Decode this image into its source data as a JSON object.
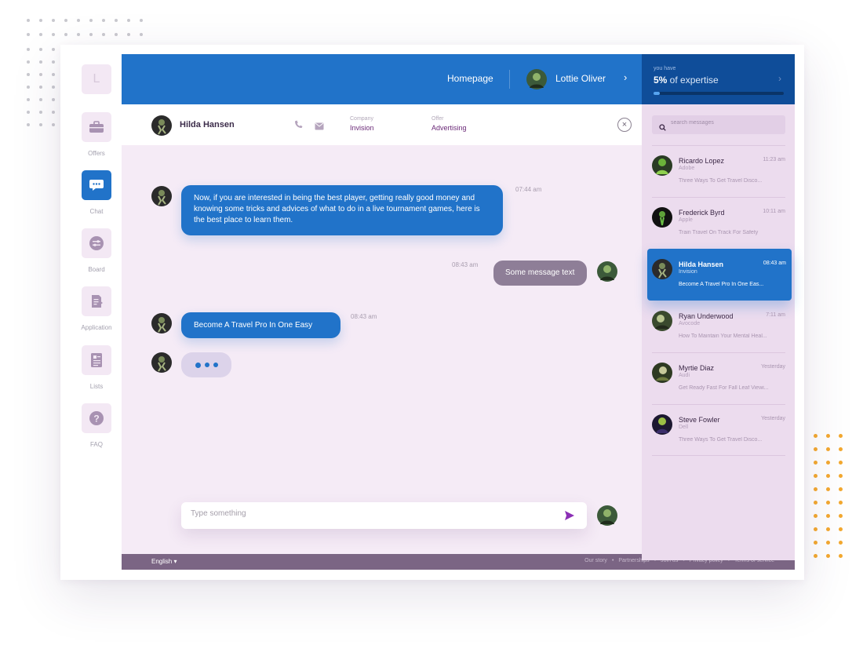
{
  "colors": {
    "accent": "#2173c9",
    "accent_dark": "#0f4d99",
    "panel": "#f5ebf6",
    "sidebar_right": "#ecdcee",
    "footer": "#7b6584",
    "decor_orange": "#f4a92f"
  },
  "nav": {
    "logo_letter": "L",
    "items": [
      {
        "label": "Offers",
        "icon": "briefcase-icon",
        "active": false
      },
      {
        "label": "Chat",
        "icon": "chat-bubble-icon",
        "active": true
      },
      {
        "label": "Board",
        "icon": "sliders-icon",
        "active": false
      },
      {
        "label": "Application",
        "icon": "document-arrow-icon",
        "active": false
      },
      {
        "label": "Lists",
        "icon": "list-document-icon",
        "active": false
      },
      {
        "label": "FAQ",
        "icon": "question-icon",
        "active": false
      }
    ]
  },
  "topbar": {
    "home_label": "Homepage",
    "user_name": "Lottie Oliver"
  },
  "expertise": {
    "prefix": "you have",
    "value": "5%",
    "suffix": " of expertise",
    "progress": 0.05
  },
  "chat": {
    "contact_name": "Hilda Hansen",
    "company_key": "Company",
    "company_value": "Invision",
    "offer_key": "Offer",
    "offer_value": "Advertising",
    "messages": [
      {
        "side": "left",
        "text": "Now, if you are interested in being the best player, getting really good money and knowing some tricks and advices of what to do in a live tournament games, here is the best place to learn them.",
        "time": "07:44 am"
      },
      {
        "side": "right",
        "text": "Some message text",
        "time": "08:43 am"
      },
      {
        "side": "left",
        "text": "Become A Travel Pro In One Easy",
        "time": "08:43 am"
      }
    ],
    "composer_placeholder": "Type something"
  },
  "search": {
    "placeholder": "search messages"
  },
  "conversations": [
    {
      "name": "Ricardo Lopez",
      "time": "11:23 am",
      "company": "Adobe",
      "preview": "Three Ways To Get Travel Disco...",
      "active": false
    },
    {
      "name": "Frederick Byrd",
      "time": "10:11 am",
      "company": "Apple",
      "preview": "Train Travel On Track For Safety",
      "active": false
    },
    {
      "name": "Hilda Hansen",
      "time": "08:43 am",
      "company": "Invision",
      "preview": "Become A Travel Pro In One Eas...",
      "active": true
    },
    {
      "name": "Ryan Underwood",
      "time": "7:11 am",
      "company": "Avocode",
      "preview": "How To Maintain Your Mental Heal...",
      "active": false
    },
    {
      "name": "Myrtie Diaz",
      "time": "Yesterday",
      "company": "Audi",
      "preview": "Get Ready Fast For Fall Leaf Viewi...",
      "active": false
    },
    {
      "name": "Steve Fowler",
      "time": "Yesterday",
      "company": "Dell",
      "preview": "Three Ways To Get Travel Disco...",
      "active": false
    }
  ],
  "footer": {
    "language": "English",
    "links": [
      "Our story",
      "Partnerships",
      "Join us",
      "Privacy policy",
      "Terms of service"
    ]
  }
}
